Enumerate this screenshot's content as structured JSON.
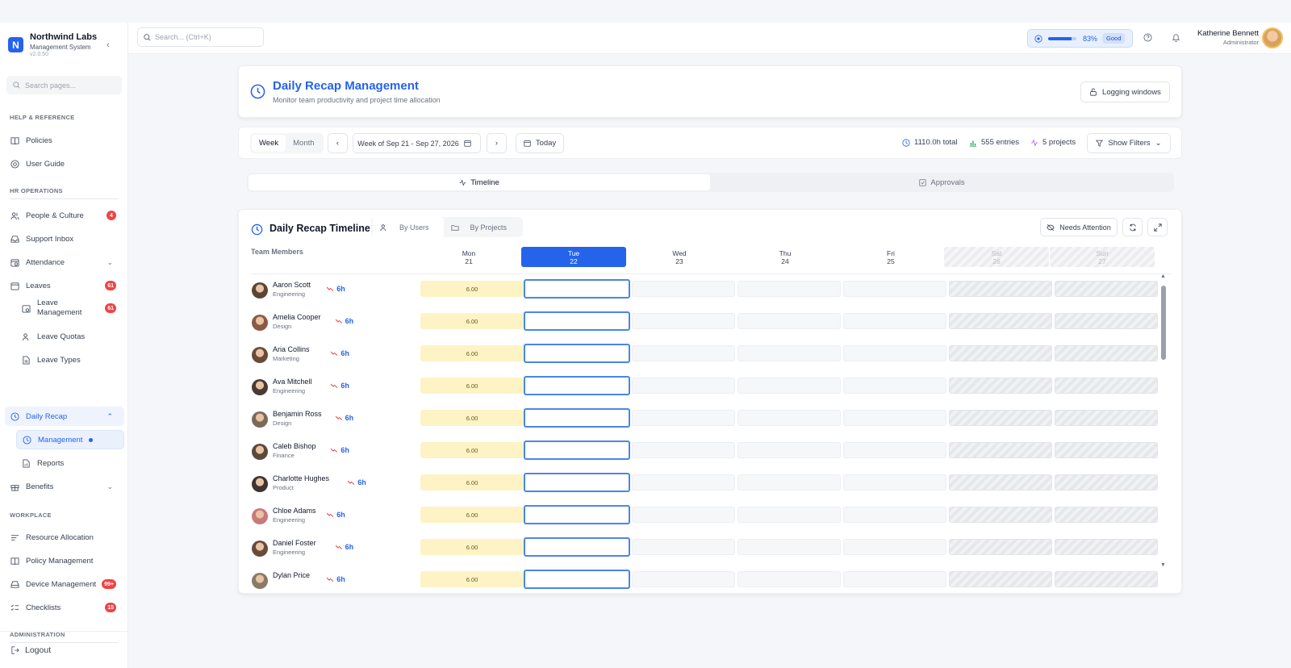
{
  "brand": {
    "name": "Northwind Labs",
    "subtitle": "Management System",
    "version": "v2.0.50",
    "logo_letter": "N"
  },
  "sidebar": {
    "search_placeholder": "Search pages...",
    "sections": {
      "help": "HELP & REFERENCE",
      "hr": "HR OPERATIONS",
      "workplace": "WORKPLACE",
      "admin": "ADMINISTRATION"
    },
    "items": {
      "policies": "Policies",
      "user_guide": "User Guide",
      "people": "People & Culture",
      "people_badge": "4",
      "support": "Support Inbox",
      "attendance": "Attendance",
      "leaves": "Leaves",
      "leaves_badge": "61",
      "leave_mgmt": "Leave Management",
      "leave_mgmt_badge": "61",
      "leave_quotas": "Leave Quotas",
      "leave_types": "Leave Types",
      "daily_recap": "Daily Recap",
      "management": "Management",
      "reports": "Reports",
      "benefits": "Benefits",
      "resource_alloc": "Resource Allocation",
      "policy_mgmt": "Policy Management",
      "device_mgmt": "Device Management",
      "device_badge": "99+",
      "checklists": "Checklists",
      "checklists_badge": "15"
    },
    "logout": "Logout"
  },
  "topbar": {
    "search_placeholder": "Search... (Ctrl+K)",
    "performance_pct": "83%",
    "performance_value": 0.83,
    "performance_label": "Good",
    "user_name": "Katherine Bennett",
    "user_role": "Administrator"
  },
  "header": {
    "title": "Daily Recap Management",
    "subtitle": "Monitor team productivity and project time allocation",
    "logging_button": "Logging windows"
  },
  "toolbar": {
    "week": "Week",
    "month": "Month",
    "range": "Week of Sep 21 - Sep 27, 2026",
    "today": "Today",
    "total": "1110.0h total",
    "entries": "555 entries",
    "projects": "5 projects",
    "filters": "Show Filters"
  },
  "tabs": {
    "timeline": "Timeline",
    "approvals": "Approvals"
  },
  "timeline": {
    "title": "Daily Recap Timeline",
    "by_users": "By Users",
    "by_projects": "By Projects",
    "needs_attention": "Needs Attention",
    "members_label": "Team Members",
    "days": [
      {
        "name": "Mon",
        "num": "21"
      },
      {
        "name": "Tue",
        "num": "22"
      },
      {
        "name": "Wed",
        "num": "23"
      },
      {
        "name": "Thu",
        "num": "24"
      },
      {
        "name": "Fri",
        "num": "25"
      },
      {
        "name": "Sat",
        "num": "26"
      },
      {
        "name": "Sun",
        "num": "27"
      }
    ],
    "members": [
      {
        "name": "Aaron Scott",
        "dept": "Engineering",
        "hours": "6h",
        "mon": "6.00"
      },
      {
        "name": "Amelia Cooper",
        "dept": "Design",
        "hours": "6h",
        "mon": "6.00"
      },
      {
        "name": "Aria Collins",
        "dept": "Marketing",
        "hours": "6h",
        "mon": "6.00"
      },
      {
        "name": "Ava Mitchell",
        "dept": "Engineering",
        "hours": "6h",
        "mon": "6.00"
      },
      {
        "name": "Benjamin Ross",
        "dept": "Design",
        "hours": "6h",
        "mon": "6.00"
      },
      {
        "name": "Caleb Bishop",
        "dept": "Finance",
        "hours": "6h",
        "mon": "6.00"
      },
      {
        "name": "Charlotte Hughes",
        "dept": "Product",
        "hours": "6h",
        "mon": "6.00"
      },
      {
        "name": "Chloe Adams",
        "dept": "Engineering",
        "hours": "6h",
        "mon": "6.00"
      },
      {
        "name": "Daniel Foster",
        "dept": "Engineering",
        "hours": "6h",
        "mon": "6.00"
      },
      {
        "name": "Dylan Price",
        "dept": "",
        "hours": "6h",
        "mon": "6.00"
      }
    ]
  },
  "colors": {
    "accent": "#2563eb",
    "badge": "#ef4444",
    "filled_cell": "#fdf3c4"
  }
}
